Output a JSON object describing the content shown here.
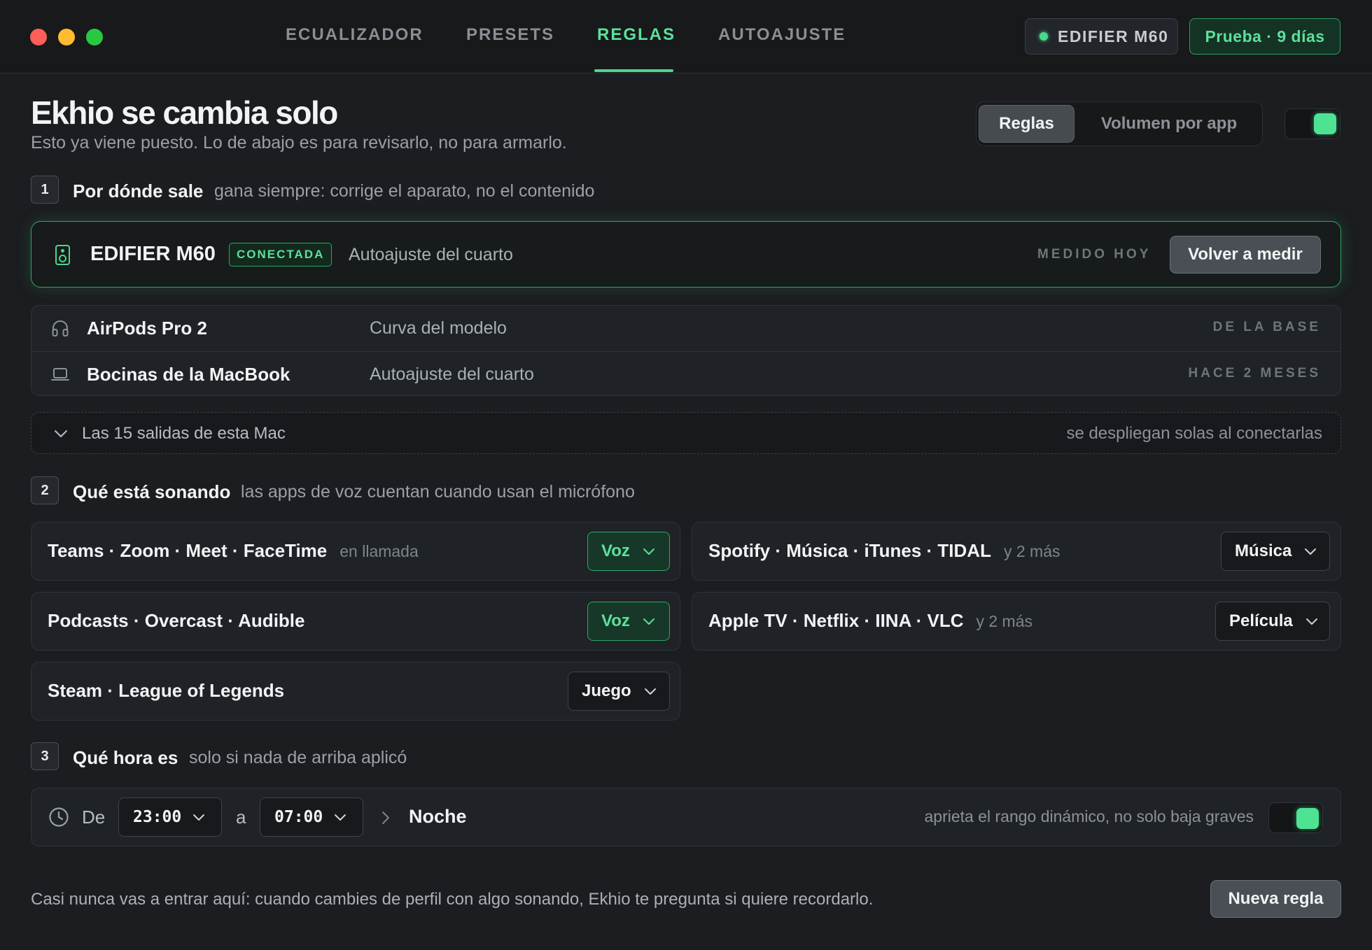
{
  "window": {
    "tabs": [
      {
        "label": "ECUALIZADOR"
      },
      {
        "label": "PRESETS"
      },
      {
        "label": "REGLAS"
      },
      {
        "label": "AUTOAJUSTE"
      }
    ],
    "active_tab": "REGLAS",
    "device_pill": "EDIFIER M60",
    "trial_pill": "Prueba · 9 días"
  },
  "header": {
    "title": "Ekhio se cambia solo",
    "subtitle": "Esto ya viene puesto. Lo de abajo es para revisarlo, no para armarlo.",
    "segments": [
      "Reglas",
      "Volumen por app"
    ],
    "selected_segment": "Reglas",
    "enabled": true
  },
  "section1": {
    "number": "1",
    "title": "Por dónde sale",
    "hint": "gana siempre: corrige el aparato, no el contenido",
    "primary": {
      "name": "EDIFIER M60",
      "badge": "CONECTADA",
      "desc": "Autoajuste del cuarto",
      "meta": "MEDIDO HOY",
      "button": "Volver a medir",
      "icon": "speaker-icon"
    },
    "devices": [
      {
        "name": "AirPods Pro 2",
        "desc": "Curva del modelo",
        "meta": "DE LA BASE",
        "icon": "headphones-icon"
      },
      {
        "name": "Bocinas de la MacBook",
        "desc": "Autoajuste del cuarto",
        "meta": "HACE 2 MESES",
        "icon": "laptop-icon"
      }
    ],
    "outputs": {
      "label": "Las 15 salidas de esta Mac",
      "hint": "se despliegan solas al conectarlas"
    }
  },
  "section2": {
    "number": "2",
    "title": "Qué está sonando",
    "hint": "las apps de voz cuentan cuando usan el micrófono",
    "rules": [
      {
        "apps": "Teams · Zoom · Meet · FaceTime",
        "sub": "en llamada",
        "profile": "Voz",
        "accent": "#5ce09b"
      },
      {
        "apps": "Spotify · Música · iTunes · TIDAL",
        "sub": "y 2 más",
        "profile": "Música"
      },
      {
        "apps": "Podcasts · Overcast · Audible",
        "sub": "",
        "profile": "Voz",
        "accent": "#5ce09b"
      },
      {
        "apps": "Apple TV · Netflix · IINA · VLC",
        "sub": "y 2 más",
        "profile": "Película"
      },
      {
        "apps": "Steam · League of Legends",
        "sub": "",
        "profile": "Juego"
      }
    ]
  },
  "section3": {
    "number": "3",
    "title": "Qué hora es",
    "hint": "solo si nada de arriba aplicó",
    "rule": {
      "from_label": "De",
      "from": "23:00",
      "to_label": "a",
      "to": "07:00",
      "profile": "Noche",
      "hint": "aprieta el rango dinámico, no solo baja graves",
      "enabled": true
    }
  },
  "footer": {
    "note": "Casi nunca vas a entrar aquí: cuando cambies de perfil con algo sonando, Ekhio te pregunta si quiere recordarlo.",
    "button": "Nueva regla"
  },
  "colors": {
    "accent": "#4ad88c",
    "background": "#1b1d20",
    "card": "#1f2226"
  }
}
